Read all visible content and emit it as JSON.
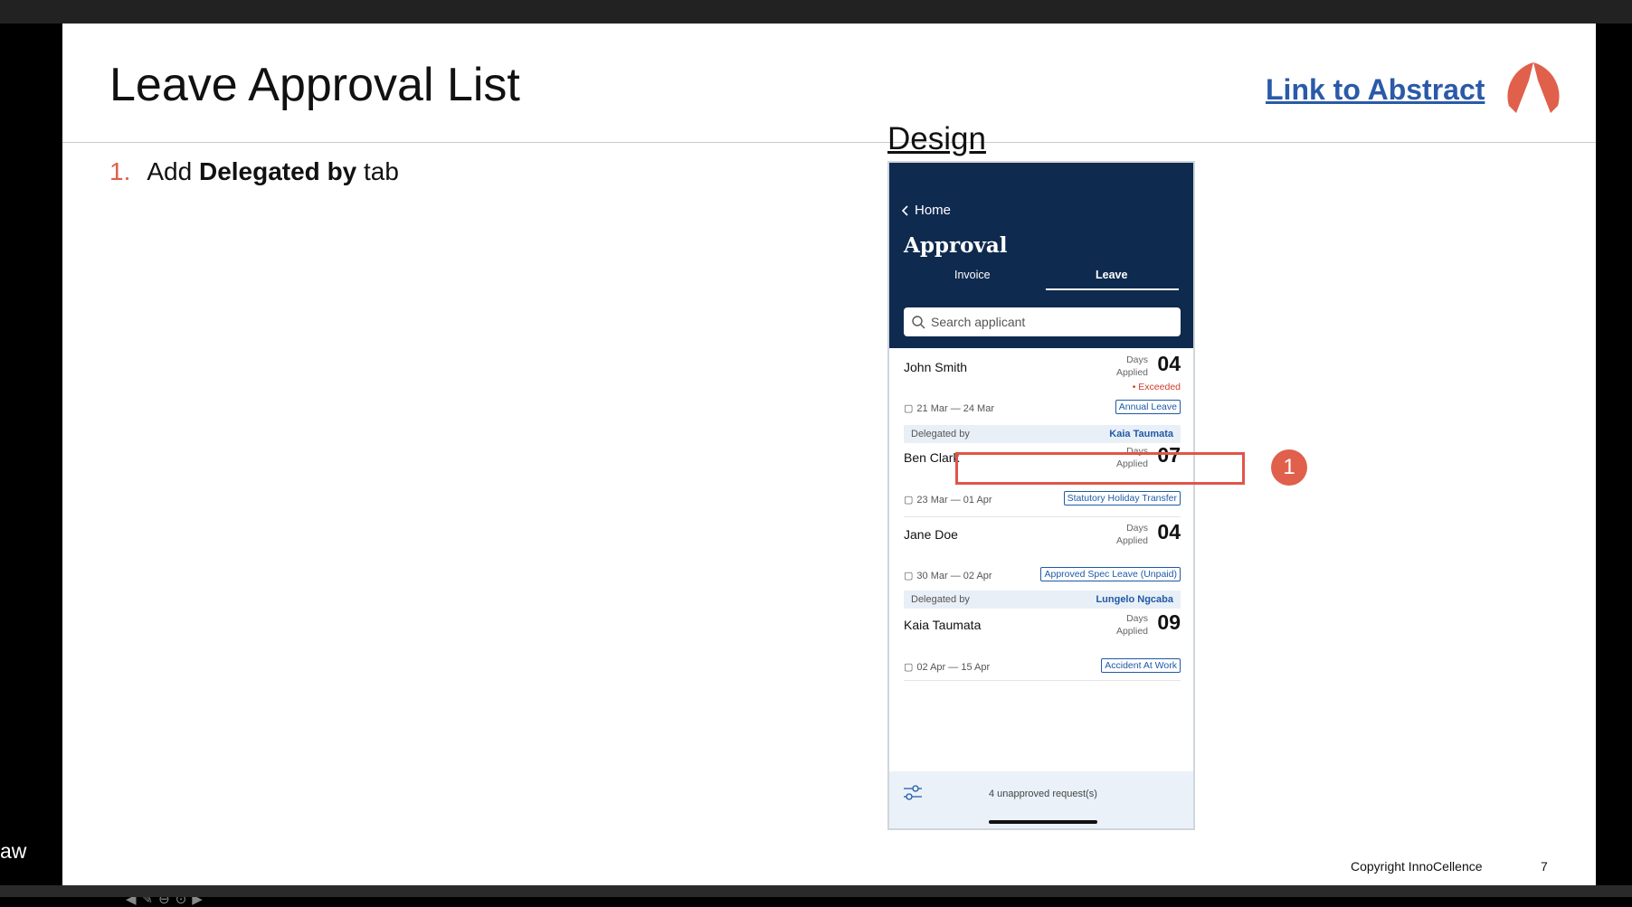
{
  "slide": {
    "title": "Leave Approval List",
    "abstract_link": "Link to Abstract",
    "bullet_number": "1.",
    "bullet_prefix": "Add ",
    "bullet_bold": "Delegated by",
    "bullet_suffix": " tab",
    "design_label": "Design",
    "marker_number": "1",
    "copyright": "Copyright InnoCellence",
    "page_number": "7",
    "side_text": "aw"
  },
  "app": {
    "back_label": "Home",
    "title": "Approval",
    "tabs": [
      {
        "label": "Invoice",
        "active": false
      },
      {
        "label": "Leave",
        "active": true
      }
    ],
    "search_placeholder": "Search applicant",
    "days_word": "Days",
    "applied_word": "Applied",
    "delegated_label": "Delegated by",
    "requests": [
      {
        "name": "John Smith",
        "days": "04",
        "status": "• Exceeded",
        "dates": "21 Mar — 24 Mar",
        "type": "Annual Leave",
        "delegated_by": "Kaia Taumata"
      },
      {
        "name": "Ben Clark",
        "days": "07",
        "status": "",
        "dates": "23 Mar — 01 Apr",
        "type": "Statutory Holiday Transfer",
        "delegated_by": ""
      },
      {
        "name": "Jane Doe",
        "days": "04",
        "status": "",
        "dates": "30 Mar — 02 Apr",
        "type": "Approved Spec Leave (Unpaid)",
        "delegated_by": "Lungelo Ngcaba"
      },
      {
        "name": "Kaia Taumata",
        "days": "09",
        "status": "",
        "dates": "02 Apr — 15 Apr",
        "type": "Accident At Work",
        "delegated_by": ""
      }
    ],
    "footer_count": "4 unapproved request(s)"
  },
  "colors": {
    "header_bg": "#0f2a4f",
    "accent": "#e0604c",
    "tag_blue": "#1f5aa6",
    "exceeded_red": "#d23b2c",
    "link_blue": "#2a5aa8"
  }
}
